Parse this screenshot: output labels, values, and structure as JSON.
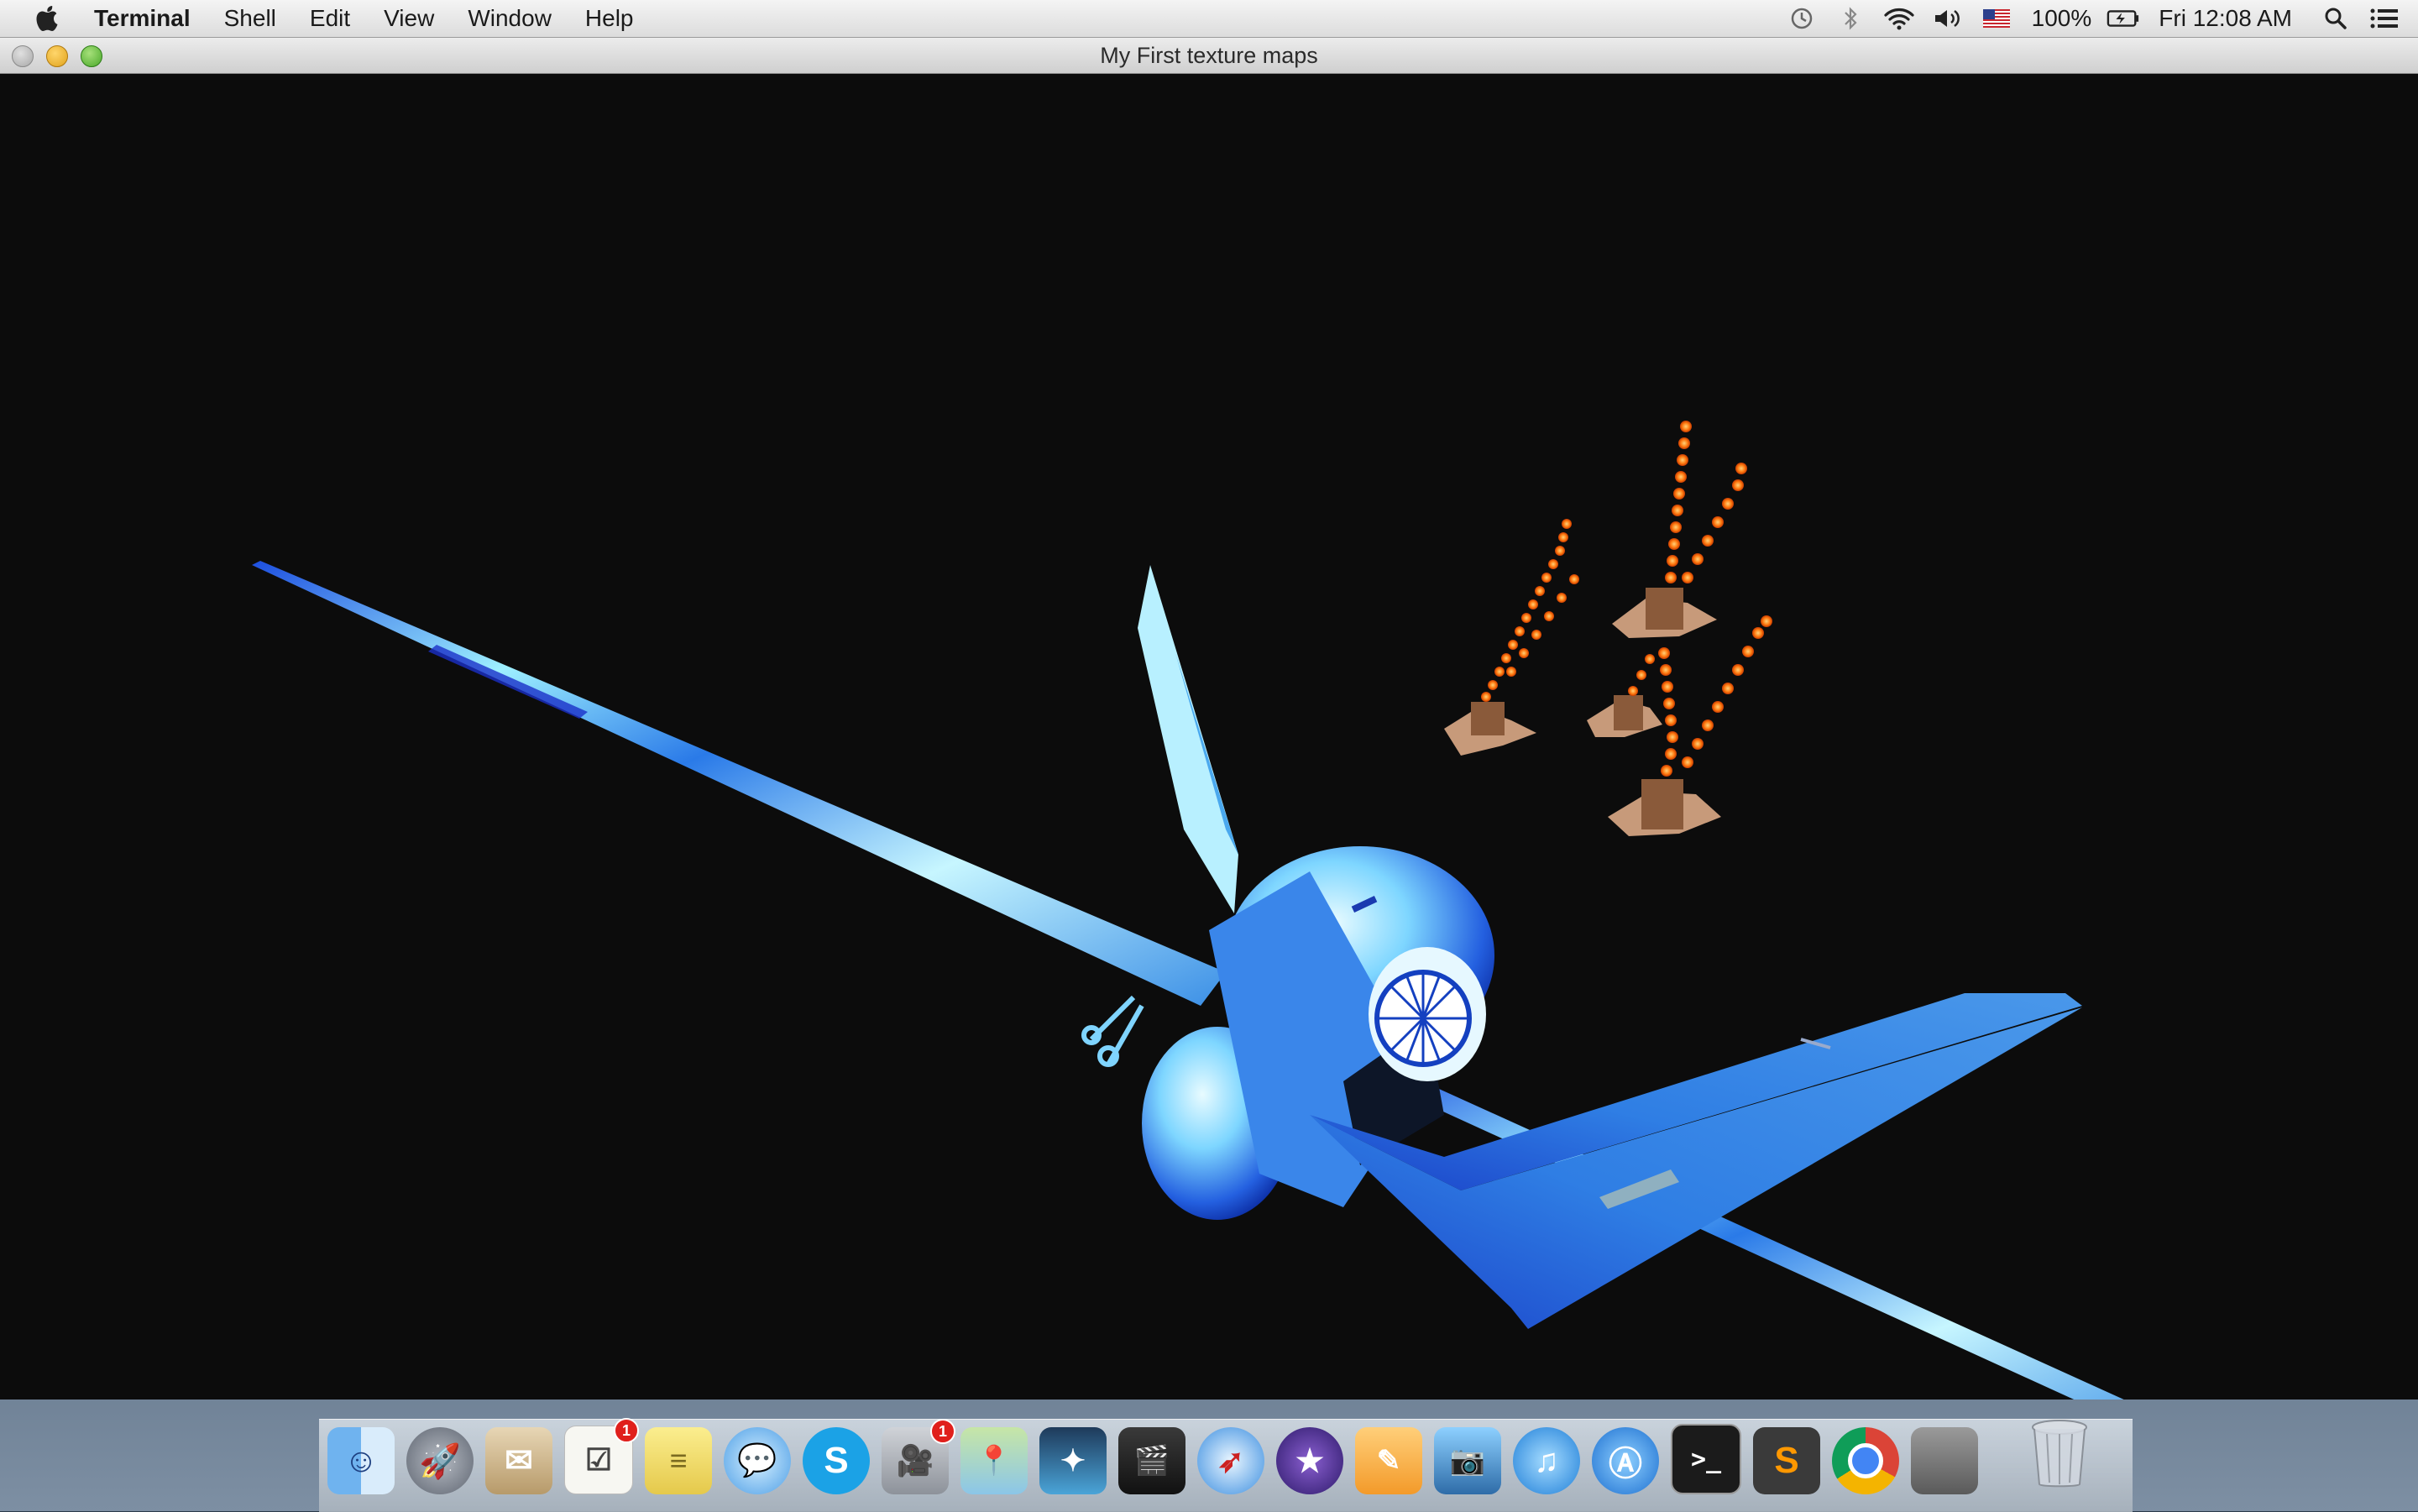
{
  "menubar": {
    "app_name": "Terminal",
    "menus": [
      "Shell",
      "Edit",
      "View",
      "Window",
      "Help"
    ],
    "battery": "100%",
    "clock": "Fri 12:08 AM",
    "status_icons": [
      "time-machine-icon",
      "bluetooth-icon",
      "wifi-icon",
      "volume-icon",
      "input-flag-icon",
      "battery-icon",
      "spotlight-icon",
      "notification-center-icon"
    ]
  },
  "window": {
    "title": "My First texture maps"
  },
  "dock": {
    "apps": [
      {
        "name": "Finder",
        "icon": "finder-icon",
        "badge": ""
      },
      {
        "name": "Launchpad",
        "icon": "launchpad-icon",
        "badge": ""
      },
      {
        "name": "Mail",
        "icon": "mail-icon",
        "badge": ""
      },
      {
        "name": "Reminders",
        "icon": "reminders-icon",
        "badge": "1"
      },
      {
        "name": "Notes",
        "icon": "notes-icon",
        "badge": ""
      },
      {
        "name": "Messages",
        "icon": "messages-icon",
        "badge": ""
      },
      {
        "name": "Skype",
        "icon": "skype-icon",
        "badge": ""
      },
      {
        "name": "FaceTime",
        "icon": "facetime-icon",
        "badge": "1"
      },
      {
        "name": "Maps",
        "icon": "maps-icon",
        "badge": ""
      },
      {
        "name": "StarCraft II",
        "icon": "starcraft-icon",
        "badge": ""
      },
      {
        "name": "Final Cut Pro",
        "icon": "finalcut-icon",
        "badge": ""
      },
      {
        "name": "Safari",
        "icon": "safari-icon",
        "badge": ""
      },
      {
        "name": "iMovie",
        "icon": "imovie-icon",
        "badge": ""
      },
      {
        "name": "Pages",
        "icon": "pages-icon",
        "badge": ""
      },
      {
        "name": "Image Capture",
        "icon": "image-capture-icon",
        "badge": ""
      },
      {
        "name": "iTunes",
        "icon": "itunes-icon",
        "badge": ""
      },
      {
        "name": "App Store",
        "icon": "app-store-icon",
        "badge": ""
      },
      {
        "name": "Terminal",
        "icon": "terminal-icon",
        "badge": ""
      },
      {
        "name": "Sublime Text",
        "icon": "sublime-icon",
        "badge": ""
      },
      {
        "name": "Chrome",
        "icon": "chrome-icon",
        "badge": ""
      },
      {
        "name": "Window",
        "icon": "window-icon",
        "badge": ""
      }
    ],
    "trash": "trash-icon"
  },
  "colors": {
    "scene_background": "#0c0c0c",
    "plane_light": "#bff4ff",
    "plane_mid": "#2f8ff0",
    "plane_dark": "#0a2fb0",
    "fire": "#ff7a10",
    "stump": "#8a5a3a"
  }
}
